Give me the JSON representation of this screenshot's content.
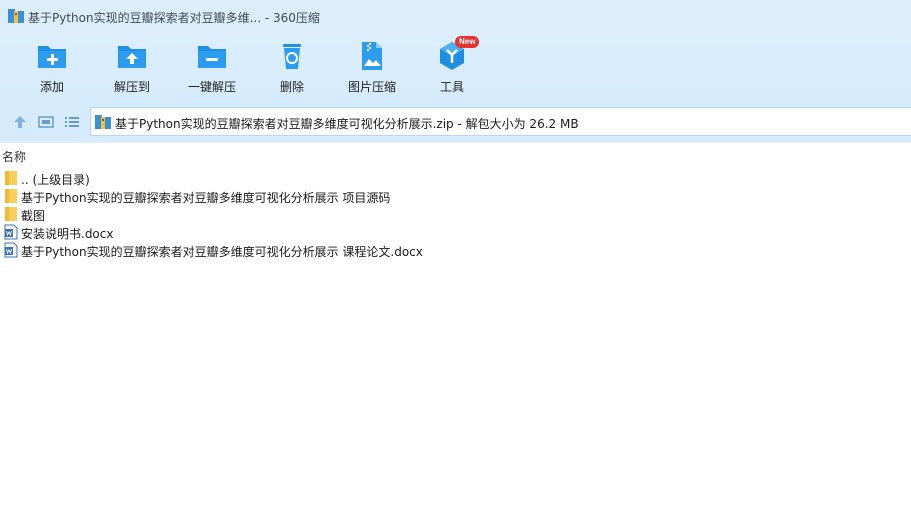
{
  "window": {
    "title": "基于Python实现的豆瓣探索者对豆瓣多维... - 360压缩"
  },
  "toolbar": {
    "items": [
      {
        "label": "添加",
        "icon": "add-folder-icon"
      },
      {
        "label": "解压到",
        "icon": "extract-to-icon"
      },
      {
        "label": "一键解压",
        "icon": "one-click-extract-icon"
      },
      {
        "label": "删除",
        "icon": "recycle-bin-icon"
      },
      {
        "label": "图片压缩",
        "icon": "image-compress-icon"
      },
      {
        "label": "工具",
        "icon": "tools-icon",
        "badge": "New"
      }
    ]
  },
  "nav": {
    "up_icon": "arrow-up-icon",
    "view_icon": "view-mode-icon",
    "list_icon": "list-view-icon"
  },
  "address": {
    "path": "基于Python实现的豆瓣探索者对豆瓣多维度可视化分析展示.zip - 解包大小为 26.2 MB"
  },
  "list": {
    "column_name": "名称",
    "rows": [
      {
        "name": ".. (上级目录)",
        "type": "folder"
      },
      {
        "name": "基于Python实现的豆瓣探索者对豆瓣多维度可视化分析展示 项目源码",
        "type": "folder"
      },
      {
        "name": "截图",
        "type": "folder"
      },
      {
        "name": "安装说明书.docx",
        "type": "docx"
      },
      {
        "name": "基于Python实现的豆瓣探索者对豆瓣多维度可视化分析展示 课程论文.docx",
        "type": "docx"
      }
    ]
  },
  "colors": {
    "toolbar_bg": "#d6ebfb",
    "icon_blue": "#1e8fe1",
    "badge_red": "#e8312d"
  }
}
